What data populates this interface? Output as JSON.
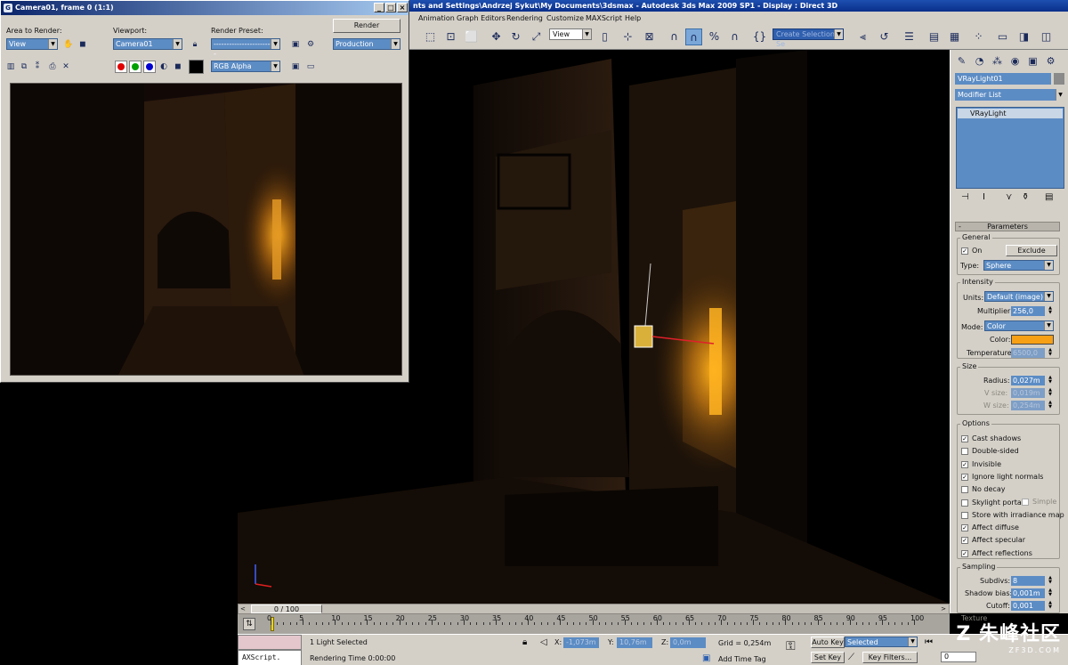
{
  "main_window": {
    "title": "nts and Settings\\Andrzej Sykut\\My Documents\\3dsmax    - Autodesk 3ds Max  2009 SP1       - Display : Direct 3D",
    "menu": [
      "Animation",
      "Graph Editors",
      "Rendering",
      "Customize",
      "MAXScript",
      "Help"
    ],
    "toolbar": {
      "reference_coord": "View",
      "named_selection_placeholder": "Create Selection Se"
    }
  },
  "render_window": {
    "title": "Camera01, frame 0 (1:1)",
    "area_label": "Area to Render:",
    "area_value": "View",
    "viewport_label": "Viewport:",
    "viewport_value": "Camera01",
    "preset_label": "Render Preset:",
    "preset_value": "--------------------------",
    "render_button": "Render",
    "production_value": "Production",
    "channel_value": "RGB Alpha"
  },
  "command_panel": {
    "object_name": "VRayLight01",
    "modifier_list": "Modifier List",
    "stack_item": "VRayLight",
    "parameters_title": "Parameters",
    "general": {
      "label": "General",
      "on_label": "On",
      "exclude_button": "Exclude",
      "type_label": "Type:",
      "type_value": "Sphere"
    },
    "intensity": {
      "label": "Intensity",
      "units_label": "Units:",
      "units_value": "Default (image)",
      "multiplier_label": "Multiplier:",
      "multiplier_value": "256,0",
      "mode_label": "Mode:",
      "mode_value": "Color",
      "color_label": "Color:",
      "color_hex": "#f7a015",
      "temperature_label": "Temperature:",
      "temperature_value": "6500,0"
    },
    "size": {
      "label": "Size",
      "radius_label": "Radius:",
      "radius_value": "0,027m",
      "v_label": "V size:",
      "v_value": "0,019m",
      "w_label": "W size:",
      "w_value": "0,254m"
    },
    "options": {
      "label": "Options",
      "items": [
        {
          "label": "Cast shadows",
          "checked": "✓"
        },
        {
          "label": "Double-sided",
          "checked": ""
        },
        {
          "label": "Invisible",
          "checked": "✓"
        },
        {
          "label": "Ignore light normals",
          "checked": "✓"
        },
        {
          "label": "No decay",
          "checked": ""
        },
        {
          "label": "Skylight portal",
          "checked": ""
        },
        {
          "label": "Store with irradiance map",
          "checked": ""
        },
        {
          "label": "Affect diffuse",
          "checked": "✓"
        },
        {
          "label": "Affect specular",
          "checked": "✓"
        },
        {
          "label": "Affect reflections",
          "checked": "✓"
        }
      ],
      "simple_label": "Simple"
    },
    "sampling": {
      "label": "Sampling",
      "subdivs_label": "Subdivs:",
      "subdivs_value": "8",
      "shadow_bias_label": "Shadow bias:",
      "shadow_bias_value": "0,001m",
      "cutoff_label": "Cutoff:",
      "cutoff_value": "0,001"
    },
    "texture_label": "Texture"
  },
  "timeline": {
    "frame_display": "0 / 100",
    "ticks": [
      "0",
      "5",
      "10",
      "15",
      "20",
      "25",
      "30",
      "35",
      "40",
      "45",
      "50",
      "55",
      "60",
      "65",
      "70",
      "75",
      "80",
      "85",
      "90",
      "95",
      "100"
    ]
  },
  "status": {
    "maxscript_label": "AXScript.",
    "selection": "1 Light Selected",
    "render_time": "Rendering Time  0:00:00",
    "x_label": "X:",
    "x_value": "-1,073m",
    "y_label": "Y:",
    "y_value": "10,76m",
    "z_label": "Z:",
    "z_value": "0,0m",
    "grid": "Grid = 0,254m",
    "add_time_tag": "Add Time Tag",
    "auto_key": "Auto Key",
    "set_key": "Set Key",
    "selected_value": "Selected",
    "key_filters": "Key Filters...",
    "frame_value": "0"
  },
  "watermark": {
    "big": "Z 朱峰社区",
    "small": "ZF3D.COM"
  }
}
